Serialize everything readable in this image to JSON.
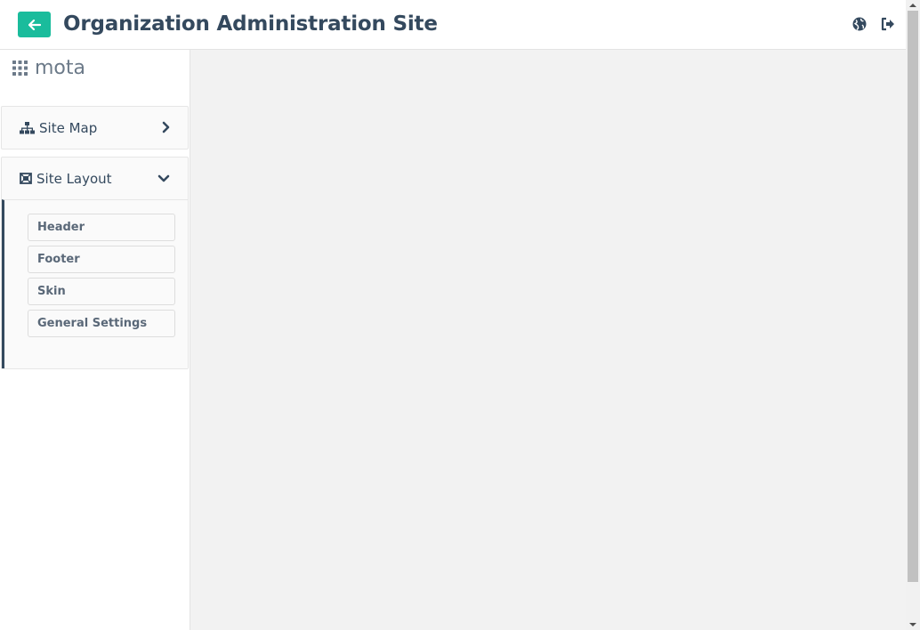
{
  "header": {
    "title": "Organization Administration Site",
    "back_icon": "arrow-left-icon",
    "globe_icon": "globe-icon",
    "logout_icon": "sign-out-icon",
    "accent_color": "#1abc9c"
  },
  "sidebar": {
    "brand": {
      "icon": "grid-icon",
      "name": "mota"
    },
    "panels": [
      {
        "label": "Site Map",
        "icon": "sitemap-icon",
        "chevron": "chevron-right-icon",
        "expanded": false
      },
      {
        "label": "Site Layout",
        "icon": "layout-icon",
        "chevron": "chevron-down-icon",
        "expanded": true,
        "items": [
          "Header",
          "Footer",
          "Skin",
          "General Settings"
        ]
      }
    ]
  }
}
